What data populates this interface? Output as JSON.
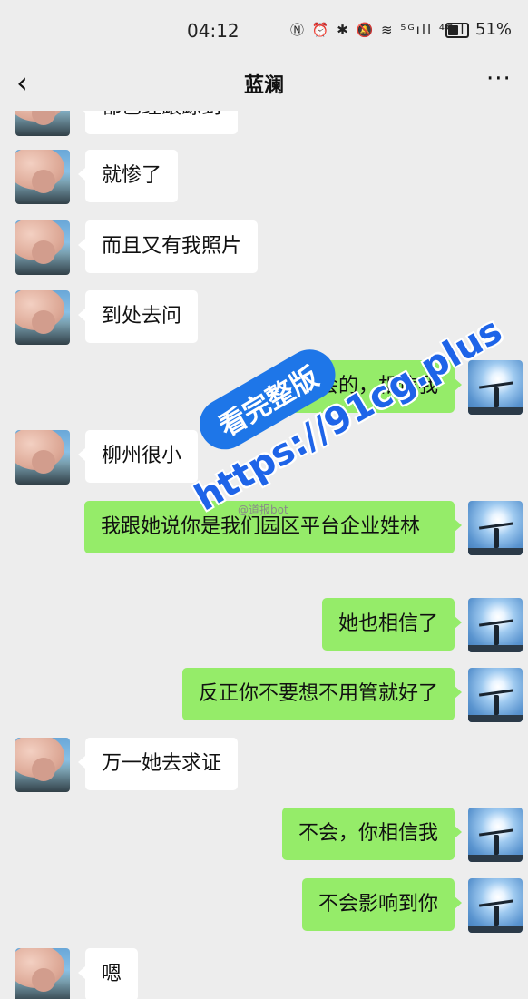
{
  "status_bar": {
    "time": "04:12",
    "icons_text": "Ⓝ ⏰ ✱ 🔕 ≋ ⁵ᴳıll ⁴ᴳıll",
    "battery": "51%"
  },
  "header": {
    "back_icon": "‹",
    "title": "蓝澜",
    "more_icon": "···"
  },
  "messages": [
    {
      "side": "in",
      "text": "都已经跟踪到"
    },
    {
      "side": "in",
      "text": "就惨了"
    },
    {
      "side": "in",
      "text": "而且又有我照片"
    },
    {
      "side": "in",
      "text": "到处去问"
    },
    {
      "side": "out",
      "text": "不会的，相信我"
    },
    {
      "side": "in",
      "text": "柳州很小"
    },
    {
      "side": "out",
      "text": "我跟她说你是我们园区平台企业姓林"
    },
    {
      "side": "out",
      "text": "她也相信了"
    },
    {
      "side": "out",
      "text": "反正你不要想不用管就好了"
    },
    {
      "side": "in",
      "text": "万一她去求证"
    },
    {
      "side": "out",
      "text": "不会，你相信我"
    },
    {
      "side": "out",
      "text": "不会影响到你"
    },
    {
      "side": "in",
      "text": "嗯"
    }
  ],
  "attribution": "@道报bot",
  "watermark": {
    "badge": "看完整版",
    "url": "https://91cg.plus"
  },
  "colors": {
    "background": "#ededed",
    "bubble_in": "#ffffff",
    "bubble_out": "#95ec69",
    "watermark_blue": "#1e76e8"
  }
}
